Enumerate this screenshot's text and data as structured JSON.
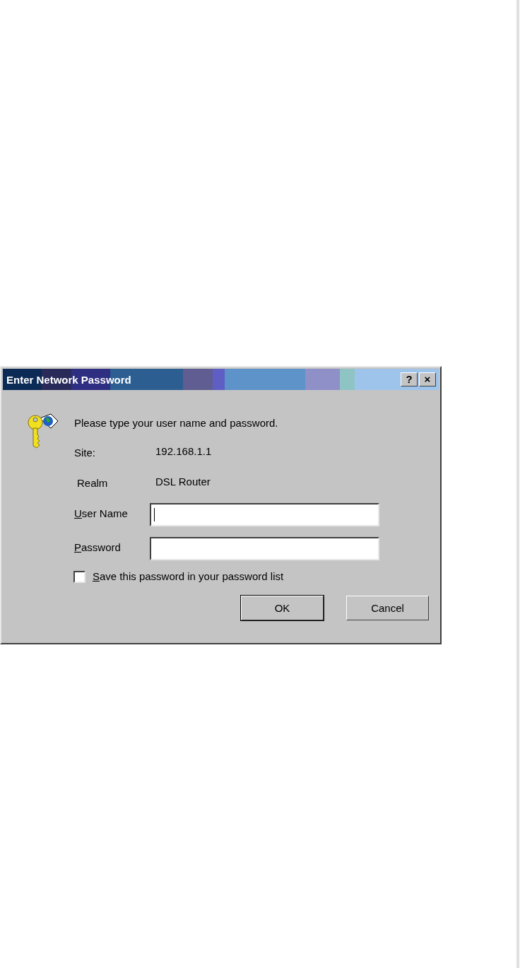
{
  "dialog": {
    "title": "Enter Network Password",
    "title_buttons": [
      "?",
      "×"
    ],
    "message": "Please type your user name and password.",
    "info": [
      {
        "label": "Site:",
        "value": "192.168.1.1"
      },
      {
        "label": "Realm",
        "value": "DSL Router"
      }
    ],
    "fields": [
      {
        "label": "User Name",
        "focused": true
      },
      {
        "label": "Password",
        "focused": false
      }
    ],
    "save_password": {
      "label": "Save this password in your password list",
      "checked": false
    },
    "buttons": [
      {
        "label": "OK",
        "default": true
      },
      {
        "label": "Cancel",
        "default": false
      }
    ]
  }
}
